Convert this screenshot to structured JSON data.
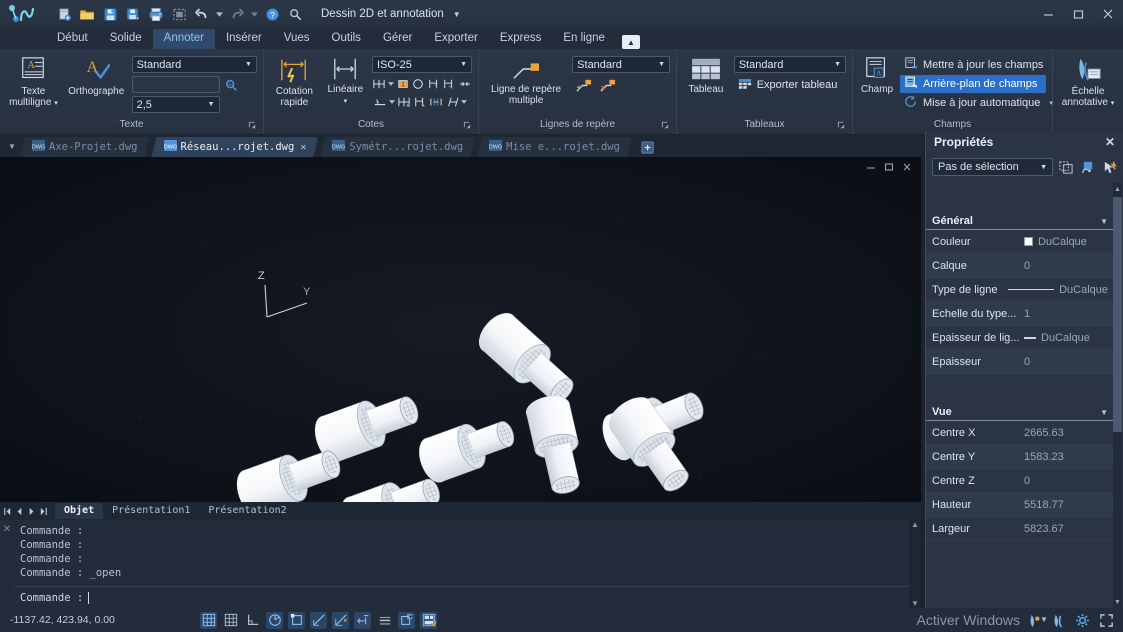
{
  "titlebar": {
    "workspace": "Dessin 2D et annotation",
    "quick_access": [
      {
        "name": "new-icon",
        "title": "Nouveau"
      },
      {
        "name": "open-folder-icon",
        "title": "Ouvrir"
      },
      {
        "name": "save-icon",
        "title": "Enregistrer"
      },
      {
        "name": "save-as-icon",
        "title": "Enregistrer sous"
      },
      {
        "name": "plot-icon",
        "title": "Tracer"
      },
      {
        "name": "plot-preview-icon",
        "title": "Aperçu"
      },
      {
        "name": "undo-icon",
        "title": "Annuler"
      },
      {
        "name": "undo-dropdown-icon",
        "title": "Historique annuler"
      },
      {
        "name": "redo-icon",
        "title": "Rétablir"
      },
      {
        "name": "redo-dropdown-icon",
        "title": "Historique rétablir"
      },
      {
        "name": "help-icon",
        "title": "Aide"
      },
      {
        "name": "search-icon",
        "title": "Rechercher"
      }
    ],
    "window_buttons": {
      "minimize": "–",
      "maximize": "❐",
      "close": "✕"
    }
  },
  "ribbon": {
    "tabs": [
      {
        "label": "Début",
        "active": false
      },
      {
        "label": "Solide",
        "active": false
      },
      {
        "label": "Annoter",
        "active": true
      },
      {
        "label": "Insérer",
        "active": false
      },
      {
        "label": "Vues",
        "active": false
      },
      {
        "label": "Outils",
        "active": false
      },
      {
        "label": "Gérer",
        "active": false
      },
      {
        "label": "Exporter",
        "active": false
      },
      {
        "label": "Express",
        "active": false
      },
      {
        "label": "En ligne",
        "active": false
      }
    ],
    "panels": [
      {
        "title": "Texte",
        "big_button": {
          "label_line1": "Texte",
          "label_line2": "multiligne",
          "icon": "mtext-icon",
          "has_dropdown": true
        },
        "second_button": {
          "label": "Orthographe",
          "icon": "spellcheck-icon"
        },
        "style_combo": "Standard",
        "search_value": "",
        "height_combo": "2,5",
        "find_icon": "find-text-icon"
      },
      {
        "title": "Cotes",
        "quick_dim": {
          "label_line1": "Cotation",
          "label_line2": "rapide",
          "icon": "quick-dimension-icon"
        },
        "linear_dim": {
          "label": "Linéaire",
          "icon": "linear-dimension-icon",
          "has_dropdown": true
        },
        "style_combo": "ISO-25",
        "tool_row_1": [
          "dim-continue-icon",
          "dim-continue-dropdown",
          "dim-ordinate-icon",
          "dim-radius-icon",
          "dim-break-icon",
          "dim-jog-icon",
          "dim-space-icon"
        ],
        "tool_row_2": [
          "dim-baseline-icon",
          "dim-baseline-dropdown",
          "dim-inspect-icon",
          "dim-update-icon",
          "dim-adjust-icon",
          "dim-oblique-icon",
          "dim-more-dropdown"
        ]
      },
      {
        "title": "Lignes de repère",
        "big_button": {
          "label_line1": "Ligne de repère",
          "label_line2": "multiple",
          "icon": "multileader-icon"
        },
        "style_combo": "Standard",
        "tools": [
          "add-leader-icon",
          "remove-leader-icon"
        ]
      },
      {
        "title": "Tableaux",
        "big_button": {
          "label": "Tableau",
          "icon": "table-icon"
        },
        "style_combo": "Standard",
        "export_label": "Exporter tableau",
        "export_icon": "export-table-icon"
      },
      {
        "title": "Champs",
        "big_button": {
          "label": "Champ",
          "icon": "field-icon"
        },
        "items": [
          {
            "label": "Mettre à jour les champs",
            "icon": "update-fields-icon",
            "selected": false
          },
          {
            "label": "Arrière-plan de champs",
            "icon": "field-background-icon",
            "selected": true
          },
          {
            "label": "Mise à jour automatique",
            "icon": "auto-update-icon",
            "selected": false,
            "has_dropdown": true
          }
        ]
      },
      {
        "title": "",
        "big_button": {
          "label_line1": "Échelle",
          "label_line2": "annotative",
          "icon": "annotative-scale-icon",
          "has_dropdown": true
        }
      }
    ]
  },
  "file_tabs": {
    "items": [
      {
        "label": "Axe-Projet.dwg",
        "active": false,
        "closable": false
      },
      {
        "label": "Réseau...rojet.dwg",
        "active": true,
        "closable": true
      },
      {
        "label": "Symétr...rojet.dwg",
        "active": false,
        "closable": false
      },
      {
        "label": "Mise e...rojet.dwg",
        "active": false,
        "closable": false
      }
    ],
    "new_tab_icon": "new-tab-icon",
    "overflow_icon": "chevron-down-icon"
  },
  "viewport": {
    "ucs_labels": {
      "z": "Z",
      "y": "Y"
    },
    "controls": [
      {
        "name": "viewport-minimize",
        "glyph": "–"
      },
      {
        "name": "viewport-restore",
        "glyph": "❐"
      },
      {
        "name": "viewport-close",
        "glyph": "✕"
      }
    ],
    "background": "#0c0f16",
    "objects_count": 7,
    "objects_description": "3D shaded cylindrical bushing / stepped shaft solids"
  },
  "model_tabs": {
    "nav": [
      "first-layout-icon",
      "prev-layout-icon",
      "next-layout-icon",
      "last-layout-icon"
    ],
    "items": [
      {
        "label": "Objet",
        "active": true
      },
      {
        "label": "Présentation1",
        "active": false
      },
      {
        "label": "Présentation2",
        "active": false
      }
    ]
  },
  "command_line": {
    "close_icon": "close-icon",
    "history": [
      "Commande :",
      "Commande :",
      "Commande :",
      "Commande : _open"
    ],
    "prompt": "Commande :",
    "input_value": ""
  },
  "status_bar": {
    "coordinates": "-1137.42, 423.94, 0.00",
    "toggles": [
      {
        "name": "grid-display-toggle",
        "on": true
      },
      {
        "name": "snap-mode-toggle",
        "on": false
      },
      {
        "name": "ortho-mode-toggle",
        "on": false
      },
      {
        "name": "polar-tracking-toggle",
        "on": true
      },
      {
        "name": "object-snap-toggle",
        "on": true
      },
      {
        "name": "object-snap-tracking-toggle",
        "on": true
      },
      {
        "name": "dynamic-ucs-toggle",
        "on": true
      },
      {
        "name": "dynamic-input-toggle",
        "on": true
      },
      {
        "name": "lineweight-toggle",
        "on": false
      },
      {
        "name": "transparency-toggle",
        "on": true
      },
      {
        "name": "selection-cycling-toggle",
        "on": true
      }
    ],
    "watermark": "Activer Windows",
    "right_items": [
      {
        "name": "annotation-visibility-icon"
      },
      {
        "name": "annotation-scale-icon"
      },
      {
        "name": "workspace-settings-icon"
      },
      {
        "name": "fullscreen-icon"
      }
    ],
    "scale_dropdown_icon": "chevron-down-icon"
  },
  "properties": {
    "title": "Propriétés",
    "close_icon": "close-icon",
    "selection": "Pas de sélection",
    "tools": [
      {
        "name": "quick-select-icon"
      },
      {
        "name": "select-objects-icon"
      },
      {
        "name": "quick-properties-icon"
      }
    ],
    "groups": [
      {
        "name": "Général",
        "rows": [
          {
            "key": "Couleur",
            "value": "DuCalque",
            "swatch": true
          },
          {
            "key": "Calque",
            "value": "0"
          },
          {
            "key": "Type de ligne",
            "value": "DuCalque",
            "lineswatch": true
          },
          {
            "key": "Echelle du type...",
            "value": "1"
          },
          {
            "key": "Epaisseur de lig...",
            "value": "DuCalque",
            "lineswatch_thick": true
          },
          {
            "key": "Epaisseur",
            "value": "0"
          }
        ]
      },
      {
        "name": "Vue",
        "rows": [
          {
            "key": "Centre X",
            "value": "2665.63"
          },
          {
            "key": "Centre Y",
            "value": "1583.23"
          },
          {
            "key": "Centre Z",
            "value": "0"
          },
          {
            "key": "Hauteur",
            "value": "5518.77"
          },
          {
            "key": "Largeur",
            "value": "5823.67"
          }
        ]
      }
    ]
  },
  "colors": {
    "accent": "#2a70c8",
    "tab_active": "#2f4a6b",
    "tab_active_text": "#8fc4ef",
    "ribbon_bg": "#2b3647",
    "viewport_bg": "#0c0f16",
    "panel_bg": "#2a3444",
    "icon_gold": "#e8a33d",
    "icon_blue": "#5fa8e6"
  }
}
